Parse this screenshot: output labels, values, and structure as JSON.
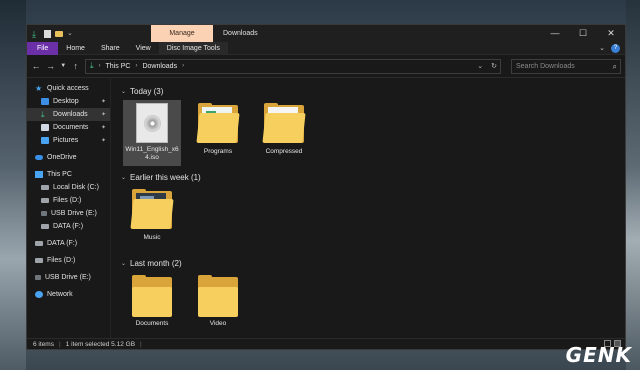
{
  "titlebar": {
    "context_tab": "Manage",
    "title": "Downloads",
    "controls": [
      "—",
      "☐",
      "✕"
    ]
  },
  "ribbon": {
    "tabs": [
      "File",
      "Home",
      "Share",
      "View",
      "Disc Image Tools"
    ],
    "help": "?"
  },
  "address": {
    "crumbs": [
      "This PC",
      "Downloads"
    ],
    "refresh": "↻",
    "dropdown": "⌄"
  },
  "search": {
    "placeholder": "Search Downloads"
  },
  "sidebar": {
    "items": [
      {
        "label": "Quick access",
        "icon": "star-icon"
      },
      {
        "label": "Desktop",
        "icon": "desktop-icon",
        "pinned": true
      },
      {
        "label": "Downloads",
        "icon": "download-icon",
        "pinned": true
      },
      {
        "label": "Documents",
        "icon": "documents-icon",
        "pinned": true
      },
      {
        "label": "Pictures",
        "icon": "pictures-icon",
        "pinned": true
      },
      {
        "label": "OneDrive",
        "icon": "cloud-icon"
      },
      {
        "label": "This PC",
        "icon": "pc-icon"
      },
      {
        "label": "Local Disk (C:)",
        "icon": "drive-icon"
      },
      {
        "label": "Files (D:)",
        "icon": "drive-icon"
      },
      {
        "label": "USB Drive (E:)",
        "icon": "usb-icon"
      },
      {
        "label": "DATA (F:)",
        "icon": "drive-icon"
      },
      {
        "label": "DATA (F:)",
        "icon": "drive-icon"
      },
      {
        "label": "Files (D:)",
        "icon": "drive-icon"
      },
      {
        "label": "USB Drive (E:)",
        "icon": "usb-icon"
      },
      {
        "label": "Network",
        "icon": "network-icon"
      }
    ]
  },
  "groups": [
    {
      "header": "Today (3)",
      "items": [
        "Win11_English_x64.iso",
        "Programs",
        "Compressed"
      ]
    },
    {
      "header": "Earlier this week (1)",
      "items": [
        "Music"
      ]
    },
    {
      "header": "Last month (2)",
      "items": [
        "Documents",
        "Video"
      ]
    }
  ],
  "status": {
    "count": "6 items",
    "selected": "1 item selected  5.12 GB"
  },
  "watermark": "GENK"
}
